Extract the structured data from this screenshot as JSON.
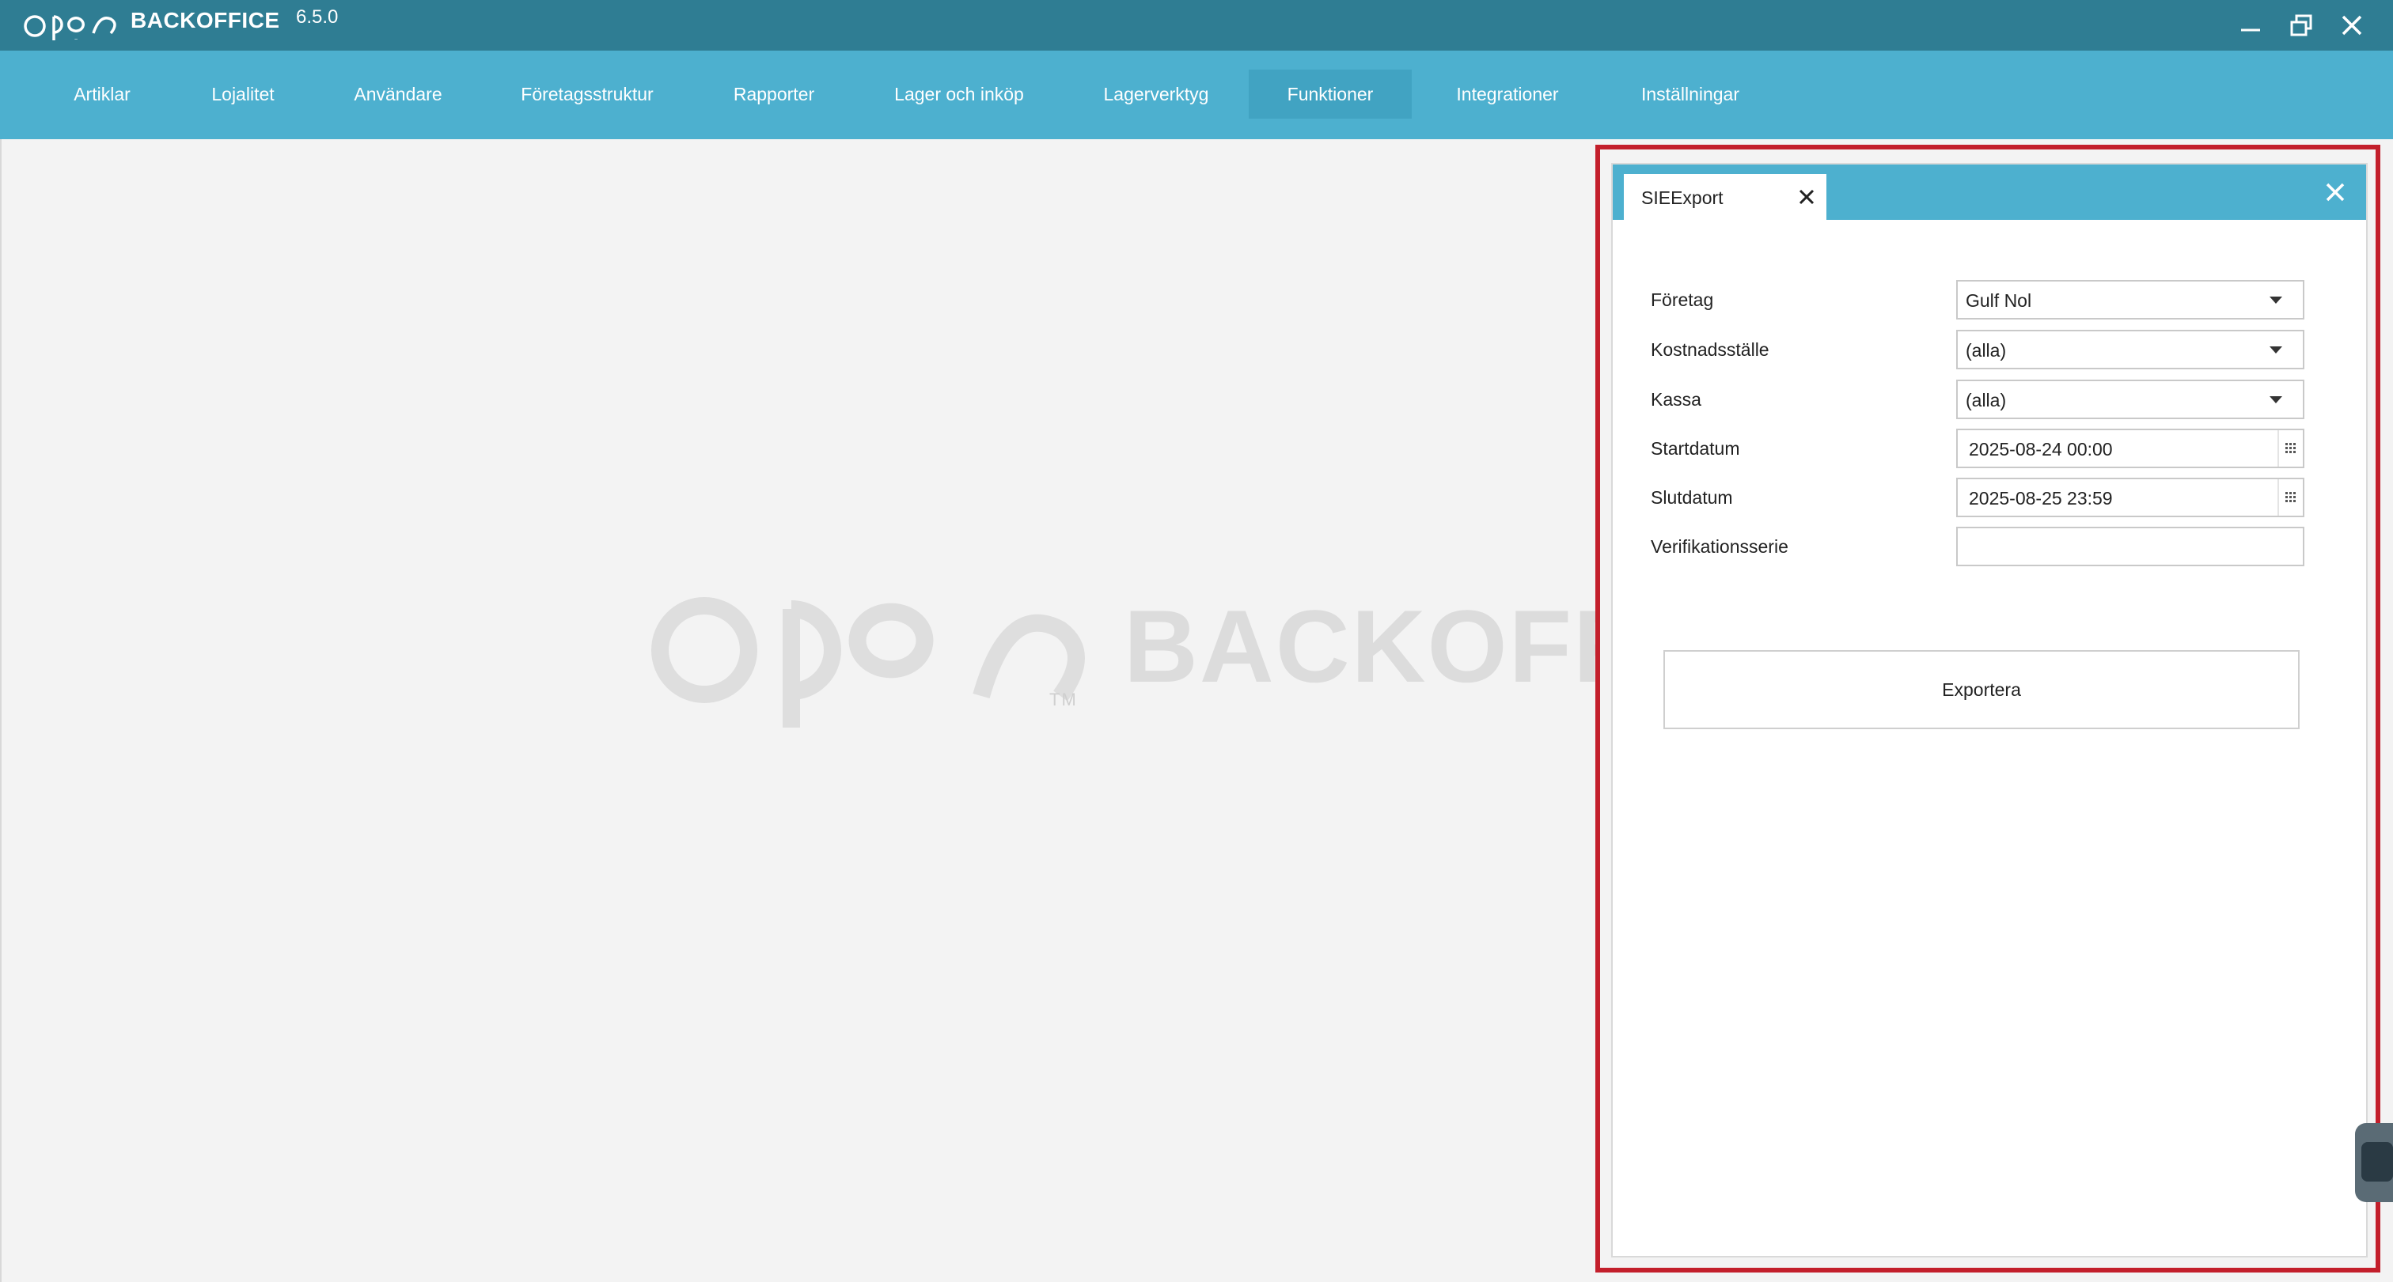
{
  "titlebar": {
    "app_name": "BACKOFFICE",
    "version": "6.5.0",
    "logo_icon": "open-logo-icon",
    "controls": [
      "minimize-icon",
      "restore-icon",
      "close-icon"
    ]
  },
  "menu": {
    "items": [
      {
        "label": "Artiklar"
      },
      {
        "label": "Lojalitet"
      },
      {
        "label": "Användare"
      },
      {
        "label": "Företagsstruktur"
      },
      {
        "label": "Rapporter"
      },
      {
        "label": "Lager och inköp"
      },
      {
        "label": "Lagerverktyg"
      },
      {
        "label": "Funktioner",
        "active": true
      },
      {
        "label": "Integrationer"
      },
      {
        "label": "Inställningar"
      }
    ]
  },
  "watermark": {
    "text": "BACKOFFICE",
    "tm": "TM"
  },
  "dialog": {
    "tab_label": "SIEExport",
    "fields": {
      "foretag": {
        "label": "Företag",
        "value": "Gulf Nol"
      },
      "kostnadsstalle": {
        "label": "Kostnadsställe",
        "value": "(alla)"
      },
      "kassa": {
        "label": "Kassa",
        "value": "(alla)"
      },
      "startdatum": {
        "label": "Startdatum",
        "value": "2025-08-24 00:00"
      },
      "slutdatum": {
        "label": "Slutdatum",
        "value": "2025-08-25 23:59"
      },
      "verifikationsserie": {
        "label": "Verifikationsserie",
        "value": ""
      }
    },
    "export_label": "Exportera"
  },
  "colors": {
    "titlebar": "#2f7d93",
    "menubar": "#4db0cf",
    "menu_active": "#41a3c2",
    "highlight": "#c31f2b",
    "workspace": "#f3f3f3"
  }
}
